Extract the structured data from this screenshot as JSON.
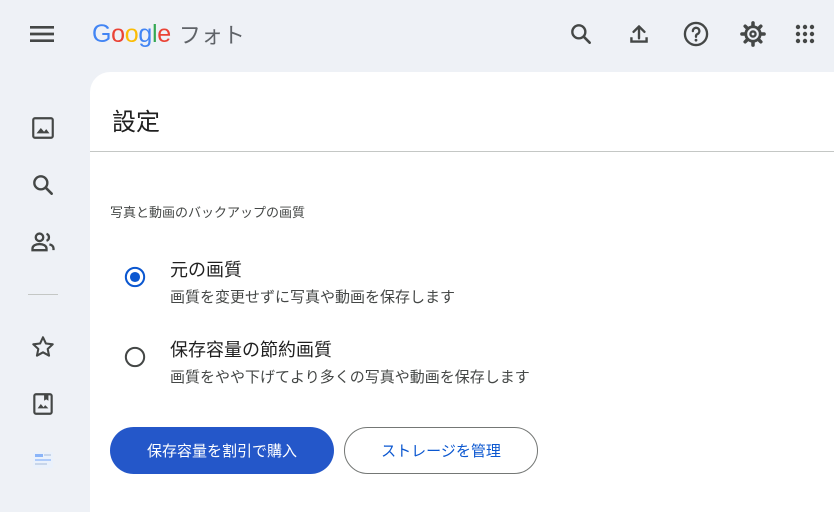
{
  "app": {
    "logo_letters": [
      "G",
      "o",
      "o",
      "g",
      "l",
      "e"
    ],
    "logo_colors": [
      "#4285F4",
      "#EA4335",
      "#FBBC05",
      "#4285F4",
      "#34A853",
      "#EA4335"
    ],
    "product_name": "フォト"
  },
  "topbar": {
    "icons": [
      "menu-icon",
      "search-icon",
      "upload-icon",
      "help-icon",
      "settings-icon",
      "apps-grid-icon"
    ]
  },
  "sidebar": {
    "icons": [
      "photos-icon",
      "search-icon",
      "sharing-icon",
      "favorites-star-icon",
      "album-icon",
      "app-thumbnail-icon"
    ]
  },
  "settings": {
    "title": "設定",
    "section_label": "写真と動画のバックアップの画質",
    "options": [
      {
        "title": "元の画質",
        "description": "画質を変更せずに写真や動画を保存します",
        "selected": true
      },
      {
        "title": "保存容量の節約画質",
        "description": "画質をやや下げてより多くの写真や動画を保存します",
        "selected": false
      }
    ],
    "buy_button_label": "保存容量を割引で購入",
    "manage_button_label": "ストレージを管理"
  },
  "colors": {
    "accent": "#0b57d0",
    "primary_button": "#2457c9",
    "background": "#eef1f6"
  }
}
